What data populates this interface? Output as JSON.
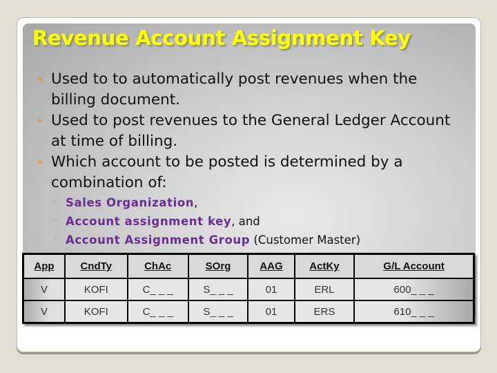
{
  "slide": {
    "title": "Revenue Account Assignment Key",
    "bullets": [
      "Used to to automatically  post revenues when the billing document.",
      "Used to post revenues to the General Ledger Account at time of billing.",
      "Which account to be posted is determined by a combination of:"
    ],
    "sub_bullets": [
      {
        "emphasis": "Sales Organization",
        "rest": ","
      },
      {
        "emphasis": "Account assignment key",
        "rest": ", and"
      },
      {
        "emphasis": "Account Assignment Group",
        "rest": " (Customer Master)"
      }
    ],
    "icons": {
      "bullet": "ornament-bullet-icon",
      "sub_bullet": "circle-bullet-icon"
    },
    "colors": {
      "title": "#ffff00",
      "emphasis": "#6a2d91",
      "bullet": "#e8953a"
    }
  },
  "table": {
    "headers": [
      "App",
      "CndTy",
      "ChAc",
      "SOrg",
      "AAG",
      "ActKy",
      "G/L Account"
    ],
    "rows": [
      [
        "V",
        "KOFI",
        "C_ _ _",
        "S_ _ _",
        "01",
        "ERL",
        "600_ _ _"
      ],
      [
        "V",
        "KOFI",
        "C_ _ _",
        "S_ _ _",
        "01",
        "ERS",
        "610_ _ _"
      ]
    ]
  }
}
